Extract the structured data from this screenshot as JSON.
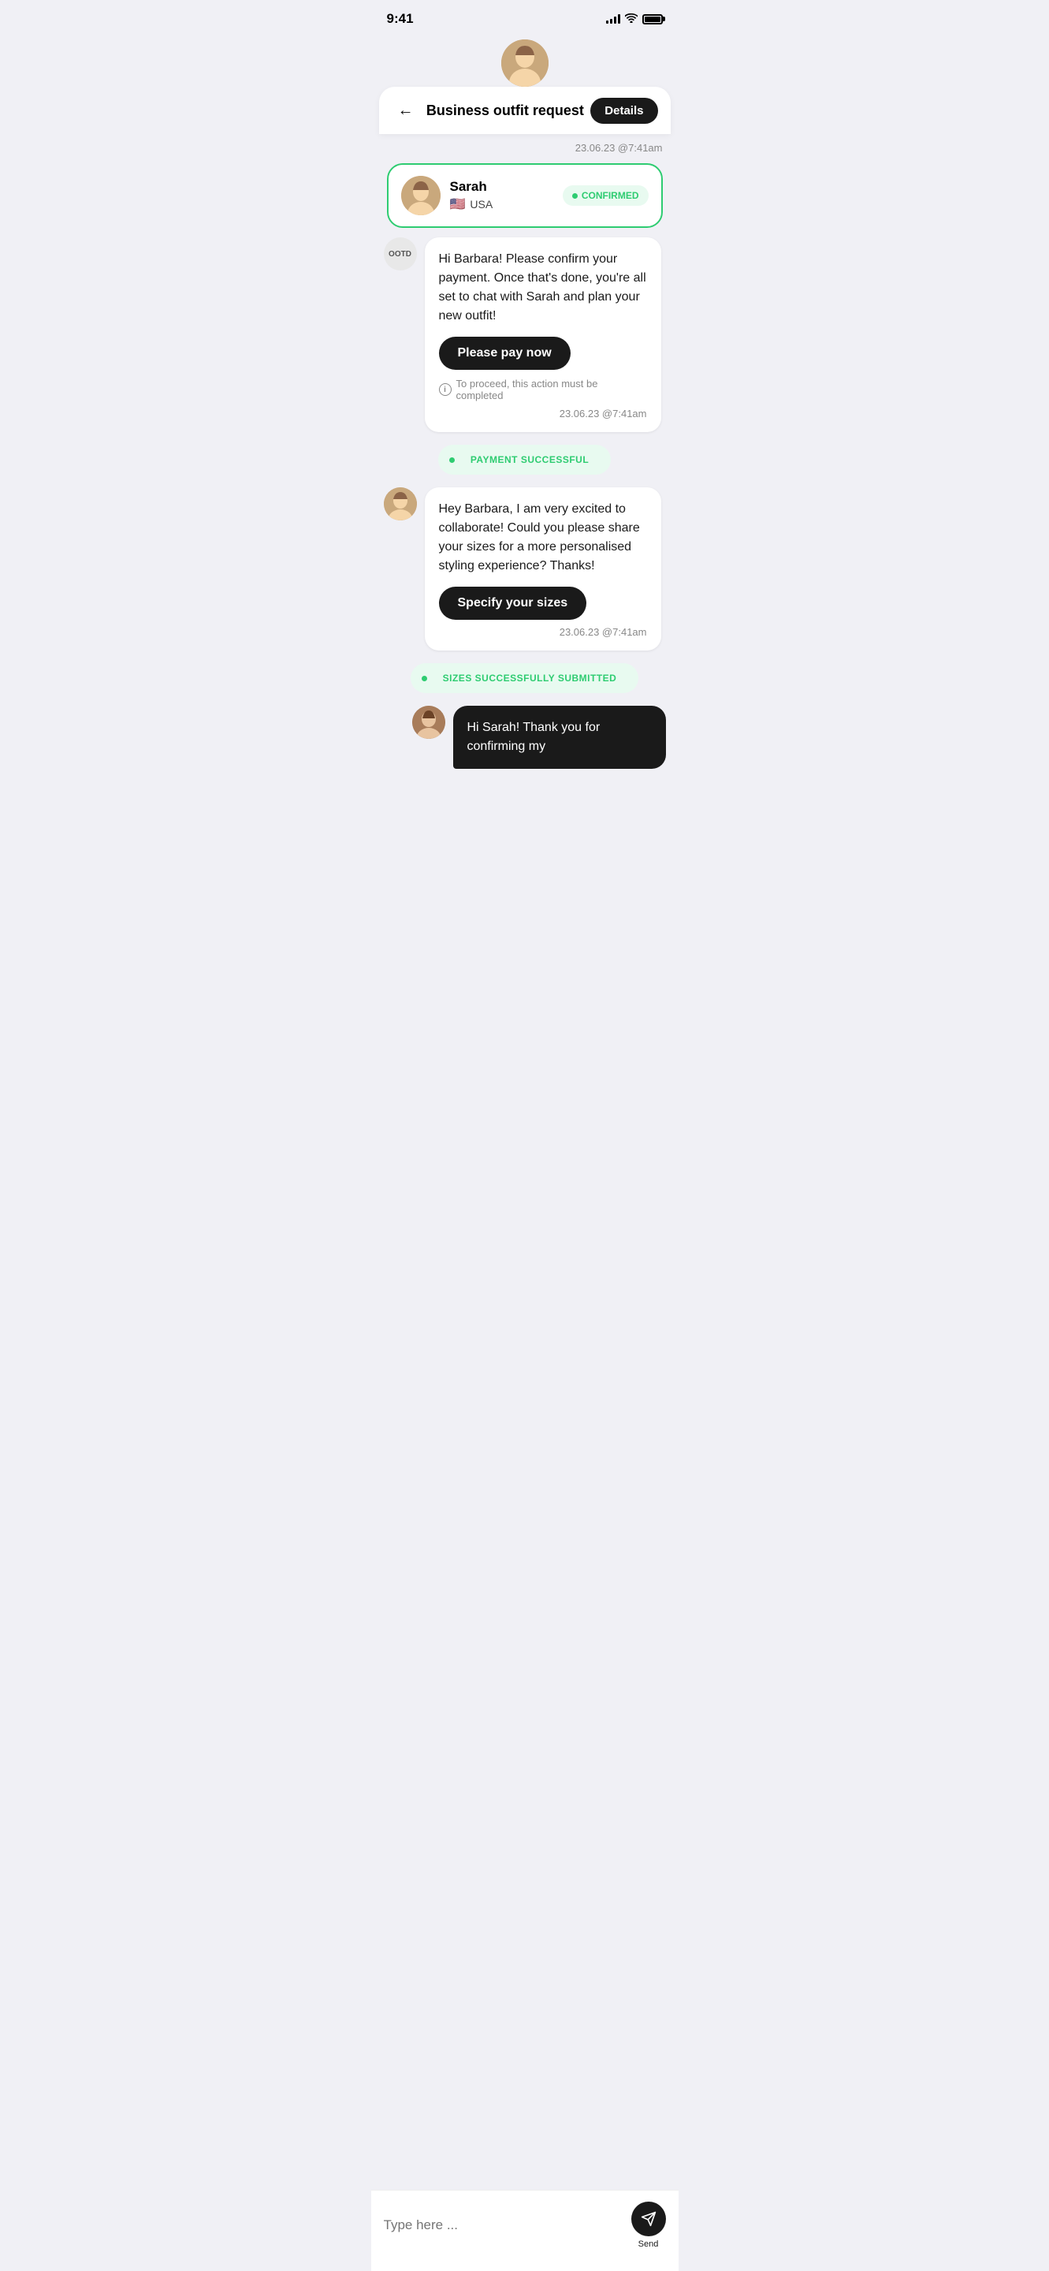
{
  "statusBar": {
    "time": "9:41",
    "icons": [
      "signal",
      "wifi",
      "battery"
    ]
  },
  "header": {
    "backLabel": "←",
    "title": "Business outfit request",
    "detailsLabel": "Details"
  },
  "profileCard": {
    "name": "Sarah",
    "country": "USA",
    "flag": "🇺🇸",
    "status": "CONFIRMED"
  },
  "messages": [
    {
      "type": "system-timestamp",
      "text": "23.06.23 @7:41am",
      "align": "right"
    },
    {
      "type": "bot",
      "sender": "OOTD",
      "text": "Hi Barbara! Please confirm your payment. Once that's done, you're all set to chat with Sarah and plan your new outfit!",
      "actionLabel": "Please pay now",
      "note": "To proceed, this action must be completed",
      "timestamp": "23.06.23 @7:41am"
    },
    {
      "type": "status",
      "text": "PAYMENT SUCCESSFUL"
    },
    {
      "type": "sarah",
      "text": "Hey Barbara, I am very excited to collaborate! Could you please share your sizes for a more personalised styling experience? Thanks!",
      "actionLabel": "Specify your sizes",
      "timestamp": "23.06.23 @7:41am"
    },
    {
      "type": "status",
      "text": "SIZES SUCCESSFULLY SUBMITTED"
    },
    {
      "type": "user-partial",
      "text": "Hi Sarah! Thank you for confirming my"
    }
  ],
  "input": {
    "placeholder": "Type here ...",
    "sendLabel": "Send"
  }
}
